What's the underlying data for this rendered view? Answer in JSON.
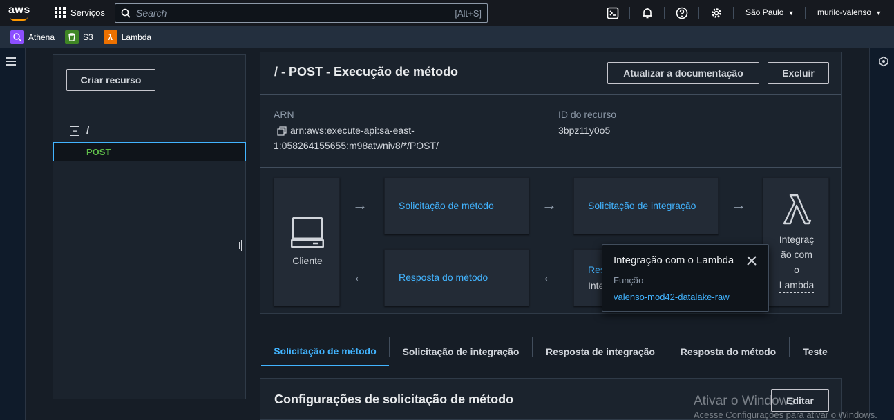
{
  "topbar": {
    "logo": "aws",
    "services_label": "Serviços",
    "search_placeholder": "Search",
    "search_shortcut": "[Alt+S]",
    "region": "São Paulo",
    "user": "murilo-valenso",
    "icons": [
      "cloudshell-icon",
      "bell-icon",
      "help-icon",
      "gear-icon"
    ]
  },
  "favorites": [
    {
      "label": "Athena",
      "icon": "athena-icon",
      "color": "#8c4fff"
    },
    {
      "label": "S3",
      "icon": "s3-icon",
      "color": "#3f8624"
    },
    {
      "label": "Lambda",
      "icon": "lambda-icon",
      "color": "#ed7100"
    }
  ],
  "resources": {
    "create_button": "Criar recurso",
    "tree": [
      {
        "label": "/",
        "collapse_glyph": "−"
      },
      {
        "label": "POST"
      }
    ]
  },
  "method": {
    "title": "/ - POST - Execução de método",
    "update_docs_button": "Atualizar a documentação",
    "delete_button": "Excluir",
    "arn_label": "ARN",
    "arn_value_line1": "arn:aws:execute-api:sa-east-",
    "arn_value_line2": "1:058264155655:m98atwniv8/*/POST/",
    "resource_id_label": "ID do recurso",
    "resource_id_value": "3bpz11y0o5"
  },
  "flow": {
    "client_label": "Cliente",
    "method_request": "Solicitação de método",
    "integration_request": "Solicitação de integração",
    "method_response": "Resposta do método",
    "integration_response_partial_1": "Res",
    "integration_response_partial_2": "Inte",
    "lambda_lines": [
      "Integraç",
      "ão com",
      "o",
      "Lambda"
    ],
    "arrow_right": "→",
    "arrow_left": "←"
  },
  "popover": {
    "title": "Integração com o Lambda",
    "function_label": "Função",
    "function_link": "valenso-mod42-datalake-raw"
  },
  "tabs": [
    {
      "label": "Solicitação de método",
      "active": true
    },
    {
      "label": "Solicitação de integração"
    },
    {
      "label": "Resposta de integração"
    },
    {
      "label": "Resposta do método"
    },
    {
      "label": "Teste"
    }
  ],
  "settings": {
    "title": "Configurações de solicitação de método",
    "edit_button": "Editar"
  },
  "watermark": {
    "line1": "Ativar o Windows",
    "line2": "Acesse Configurações para ativar o Windows."
  },
  "colors": {
    "accent": "#42b4ff",
    "active_tree_item": "#5fbd4a",
    "page_bg": "#0f1b2a",
    "topbar_bg": "#16191f"
  }
}
